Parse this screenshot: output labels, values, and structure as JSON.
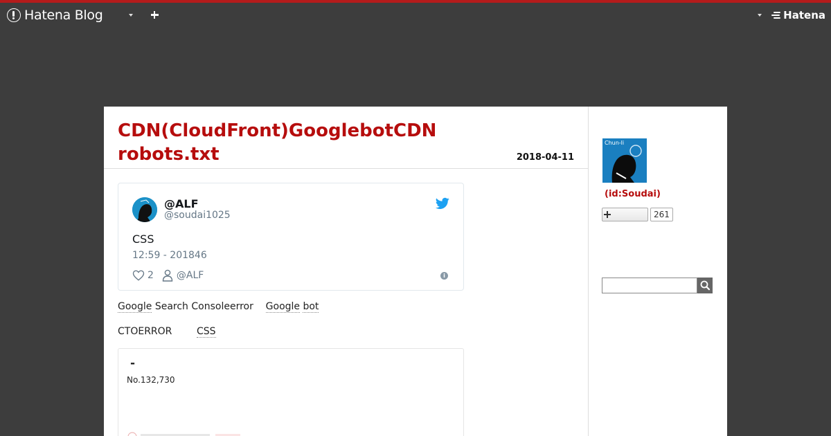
{
  "topbar": {
    "brand": "Hatena Blog",
    "hatena": "Hatena",
    "accent": "#b41b1b"
  },
  "entry": {
    "title_line1": "CDN(CloudFront)GooglebotCDN",
    "title_line2": "robots.txt",
    "date": "2018-04-11",
    "title_color": "#b60d0d"
  },
  "tweet": {
    "name": "@ALF",
    "handle": "@soudai1025",
    "text": "CSS",
    "time": "12:59 - 201846",
    "likes": "2",
    "author": "@ALF",
    "info": "i"
  },
  "body": {
    "p1_kw1": "Google",
    "p1_text1": " Search Consoleerror",
    "p1_kw2": "Google",
    "p1_kw3": "bot",
    "p2_text": "CTOERROR",
    "p2_kw": "CSS"
  },
  "embed": {
    "title": "-",
    "subtitle": "No.132,730"
  },
  "sidebar": {
    "avatar_label": "Chun-li",
    "id": "(id:Soudai)",
    "subscriber_count": "261"
  }
}
